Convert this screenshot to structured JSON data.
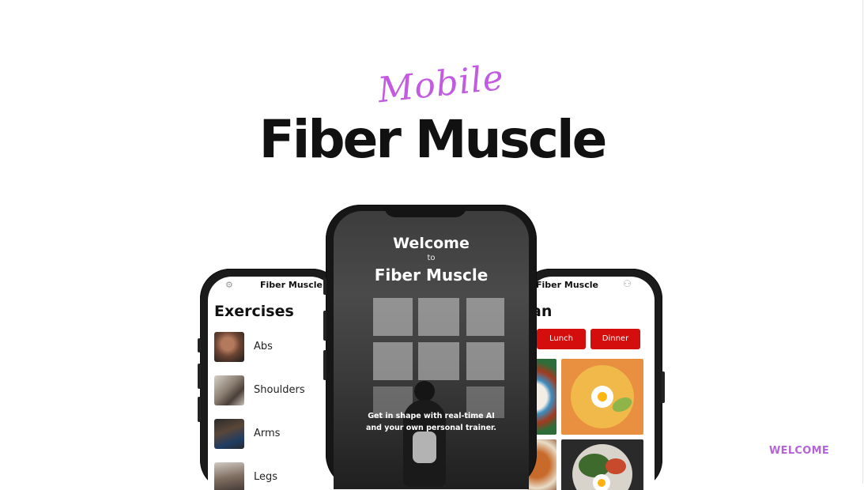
{
  "header": {
    "script_title": "Mobile",
    "title": "Fiber Muscle"
  },
  "corner_label": "WELCOME",
  "left_phone": {
    "brand": "Fiber Muscle",
    "title": "Exercises",
    "items": [
      {
        "label": "Abs"
      },
      {
        "label": "Shoulders"
      },
      {
        "label": "Arms"
      },
      {
        "label": "Legs"
      }
    ]
  },
  "center_phone": {
    "welcome": "Welcome",
    "to": "to",
    "brand": "Fiber Muscle",
    "tagline_line1": "Get in shape with real-time AI",
    "tagline_line2": "and your own personal trainer."
  },
  "right_phone": {
    "brand": "Fiber Muscle",
    "title_fragment": "an",
    "meal_buttons": [
      "Lunch",
      "Dinner"
    ]
  },
  "icons": {
    "left_header": "gear-icon",
    "right_header": "user-icon"
  }
}
